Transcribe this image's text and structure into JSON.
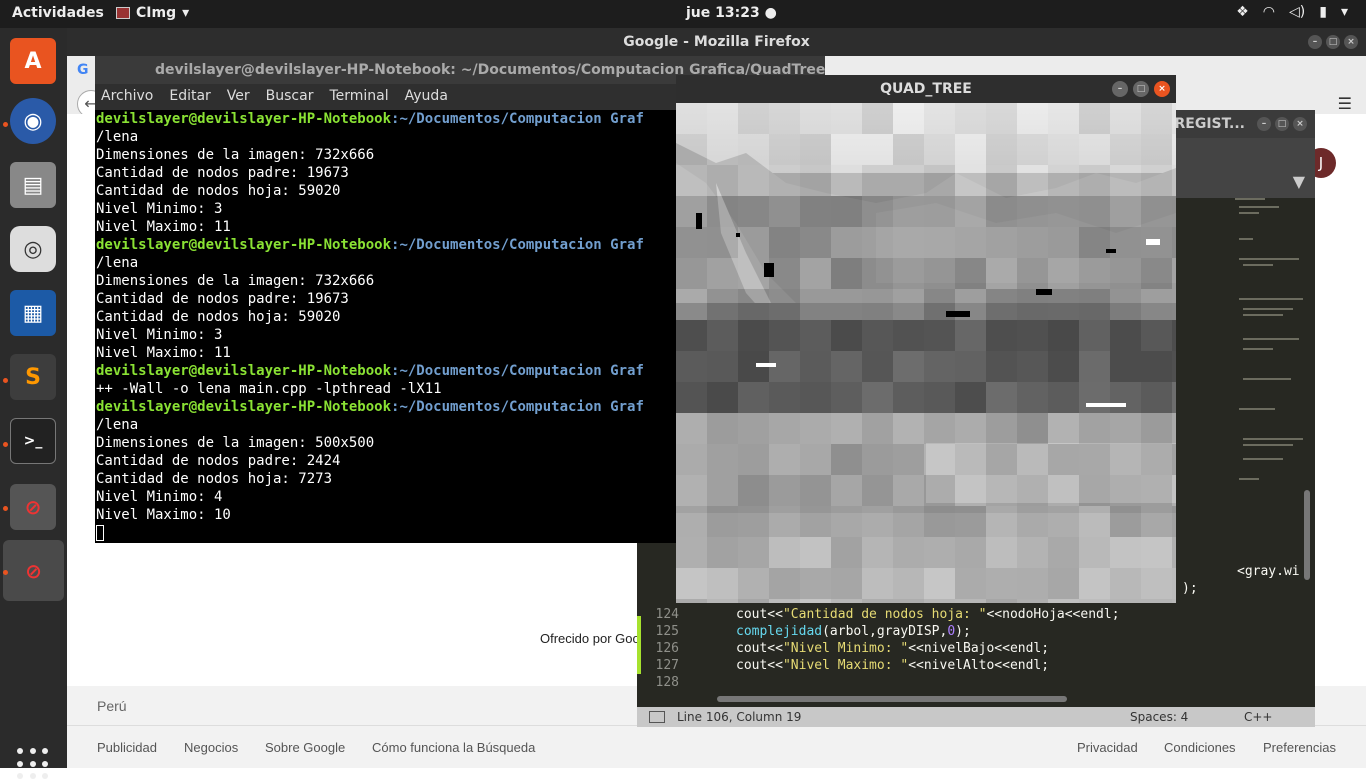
{
  "topbar": {
    "activities": "Actividades",
    "app_name": "CImg",
    "clock": "jue 13:23"
  },
  "firefox": {
    "title": "Google - Mozilla Firefox",
    "offered_by": "Ofrecido por Goo",
    "country": "Perú",
    "footer_left": [
      "Publicidad",
      "Negocios",
      "Sobre Google",
      "Cómo funciona la Búsqueda"
    ],
    "footer_right": [
      "Privacidad",
      "Condiciones",
      "Preferencias"
    ],
    "avatar_letter": "J"
  },
  "terminal": {
    "title": "devilslayer@devilslayer-HP-Notebook: ~/Documentos/Computacion Grafica/QuadTree",
    "menu": [
      "Archivo",
      "Editar",
      "Ver",
      "Buscar",
      "Terminal",
      "Ayuda"
    ],
    "prompt_user": "devilslayer@devilslayer-HP-Notebook",
    "prompt_path": ":~/Documentos/Computacion Graf",
    "run1": [
      "/lena",
      "Dimensiones de la imagen: 732x666",
      "Cantidad de nodos padre: 19673",
      "Cantidad de nodos hoja: 59020",
      "Nivel Minimo: 3",
      "Nivel Maximo: 11"
    ],
    "run2": [
      "/lena",
      "Dimensiones de la imagen: 732x666",
      "Cantidad de nodos padre: 19673",
      "Cantidad de nodos hoja: 59020",
      "Nivel Minimo: 3",
      "Nivel Maximo: 11"
    ],
    "compile": "++ -Wall -o lena main.cpp -lpthread -lX11",
    "run3": [
      "/lena",
      "Dimensiones de la imagen: 500x500",
      "Cantidad de nodos padre: 2424",
      "Cantidad de nodos hoja: 7273",
      "Nivel Minimo: 4",
      "Nivel Maximo: 10"
    ]
  },
  "sublime": {
    "title": "NREGIST...",
    "partial_line": "<gray.wi",
    "partial_line2": ");",
    "lines": [
      {
        "n": "124",
        "a": "cout<<",
        "s": "\"Cantidad de nodos hoja: \"",
        "b": "<<nodoHoja<<endl;"
      },
      {
        "n": "125",
        "fn": "complejidad",
        "a": "(arbol,grayDISP,",
        "num": "0",
        "b": ");"
      },
      {
        "n": "126",
        "a": "cout<<",
        "s": "\"Nivel Minimo: \"",
        "b": "<<nivelBajo<<endl;"
      },
      {
        "n": "127",
        "a": "cout<<",
        "s": "\"Nivel Maximo: \"",
        "b": "<<nivelAlto<<endl;"
      },
      {
        "n": "128",
        "a": "",
        "s": "",
        "b": ""
      }
    ],
    "status_pos": "Line 106, Column 19",
    "status_spaces": "Spaces: 4",
    "status_lang": "C++"
  },
  "quadtree": {
    "title": "QUAD_TREE"
  }
}
